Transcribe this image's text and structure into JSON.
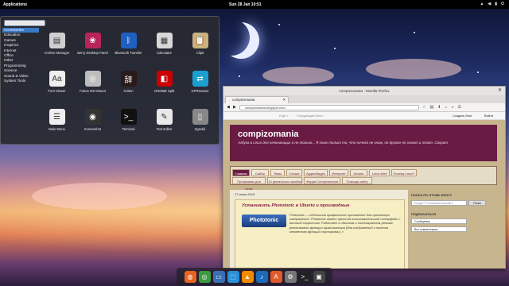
{
  "panel": {
    "applications": "Applications",
    "clock": "Sun 28 Jan   10:51"
  },
  "menu": {
    "categories": [
      "Accessories",
      "Education",
      "Games",
      "Graphics",
      "Internet",
      "Office",
      "Other",
      "Programming",
      "Science",
      "Sound & Video",
      "System Tools"
    ],
    "apps": [
      {
        "label": "Archive Manager",
        "icon": "archive-icon",
        "color": "#cfcfcf",
        "glyph": "▤"
      },
      {
        "label": "Berry Desktop Panel",
        "icon": "raspberry-icon",
        "color": "#b8245a",
        "glyph": "❀"
      },
      {
        "label": "Bluetooth Transfer",
        "icon": "bluetooth-icon",
        "color": "#1f5fbf",
        "glyph": "ᛒ"
      },
      {
        "label": "Calculator",
        "icon": "calculator-icon",
        "color": "#d8d8d8",
        "glyph": "▦"
      },
      {
        "label": "Clipit",
        "icon": "clipboard-icon",
        "color": "#c8b080",
        "glyph": "📋"
      },
      {
        "label": "Font Viewer",
        "icon": "font-viewer-icon",
        "color": "#eeeeee",
        "glyph": "Aa"
      },
      {
        "label": "Furius ISO Mount",
        "icon": "disc-icon",
        "color": "#bdbdbd",
        "glyph": "◎"
      },
      {
        "label": "GJiten",
        "icon": "dictionary-icon",
        "color": "#2a1a1a",
        "glyph": "辞"
      },
      {
        "label": "GNOME Split",
        "icon": "split-icon",
        "color": "#c00",
        "glyph": "◧"
      },
      {
        "label": "GPRename",
        "icon": "rename-icon",
        "color": "#1a9fd0",
        "glyph": "⇄"
      },
      {
        "label": "Main Menu",
        "icon": "main-menu-icon",
        "color": "#eeeeee",
        "glyph": "☰"
      },
      {
        "label": "Screenshot",
        "icon": "screenshot-icon",
        "color": "#333",
        "glyph": "◉"
      },
      {
        "label": "Terminal",
        "icon": "terminal-icon",
        "color": "#111",
        "glyph": ">_"
      },
      {
        "label": "Text Editor",
        "icon": "text-editor-icon",
        "color": "#e8e8e8",
        "glyph": "✎"
      },
      {
        "label": "Xgnokii",
        "icon": "phone-icon",
        "color": "#888",
        "glyph": "▯"
      }
    ]
  },
  "firefox": {
    "title": "compizomania - Mozilla Firefox",
    "tab": "compizomania",
    "url": "compizomania.blogspot.com",
    "blogger": {
      "more": "Ещё »",
      "next": "Следующий блог»",
      "create": "Создать блог",
      "login": "Войти"
    },
    "header": {
      "title": "compizomania",
      "desc": "Азбука в Linux для начинающих и не только... Я знаю только то, что ничего не знаю, но другие не знают и этого. Сократ"
    },
    "tabs": [
      "Главная",
      "Сайты",
      "Темы",
      "Compiz",
      "Аудио/Видео",
      "Интернет",
      "Ubuntu",
      "Linux Mint",
      "Почему Linux?",
      "Программы для Linux",
      "10 фатальных ошибок",
      "Форум Compizomania",
      "Помощь сайту"
    ],
    "date": "27 июня 2015",
    "post": {
      "title": "Установить Phototonic в Ubuntu и производные",
      "logo": "Phototonic",
      "body": "Phototonic — небольшое графическое приложение для просмотра изображений. Phototonic имеет простой пользовательский интерфейс с высокой скоростью. Работает в обычном и полноэкранном режиме, реализованы функции организатора (для изображений и наличия множества функций сортировки), с"
    },
    "sidebar": {
      "search_h": "ПОИСК ПО ЭТОМУ БЛОГУ",
      "search_ph": "Google™ Пользовательский п",
      "search_btn": "Поиск",
      "sub_h": "ПОДПИСАТЬСЯ",
      "sub1": "Сообщения",
      "sub2": "Все комментарии"
    }
  },
  "dock": [
    {
      "icon": "firefox-icon",
      "color": "#e8641e",
      "glyph": "◍"
    },
    {
      "icon": "chrome-icon",
      "color": "#3c9a40",
      "glyph": "◎"
    },
    {
      "icon": "files-icon",
      "color": "#3b6fb5",
      "glyph": "▭"
    },
    {
      "icon": "software-icon",
      "color": "#2b8fd8",
      "glyph": "⬚"
    },
    {
      "icon": "vlc-icon",
      "color": "#f08a00",
      "glyph": "▲"
    },
    {
      "icon": "amarok-icon",
      "color": "#1b6bb8",
      "glyph": "♪"
    },
    {
      "icon": "app-store-icon",
      "color": "#e05a2b",
      "glyph": "A"
    },
    {
      "icon": "settings-icon",
      "color": "#777",
      "glyph": "⚙"
    },
    {
      "icon": "terminal-icon",
      "color": "#222",
      "glyph": ">_"
    },
    {
      "icon": "screen-icon",
      "color": "#444",
      "glyph": "▣"
    }
  ]
}
